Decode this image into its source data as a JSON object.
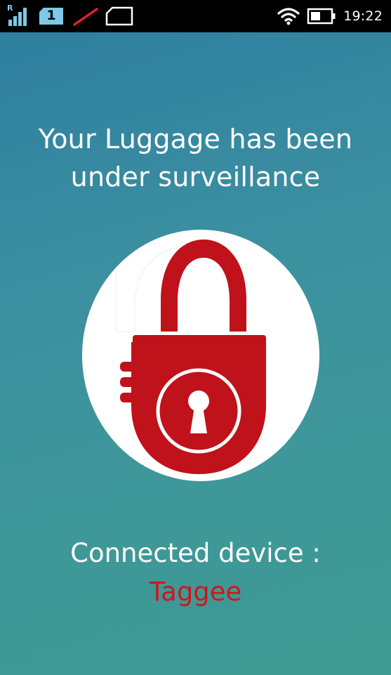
{
  "status_bar": {
    "roaming_indicator": "R",
    "sim_slot": "1",
    "time": "19:22",
    "icons": [
      "signal-roaming-icon",
      "sim-1-icon",
      "no-sim-icon",
      "wifi-icon",
      "battery-icon"
    ]
  },
  "main": {
    "headline_line1": "Your Luggage has been",
    "headline_line2": "under surveillance",
    "lock_image": "padlock-icon",
    "connected_label": "Connected device :",
    "device_name": "Taggee"
  },
  "colors": {
    "background_gradient_start": "#2f7fa0",
    "background_gradient_end": "#3f9a92",
    "lock_red": "#c0121a",
    "device_name_red": "#d0161b",
    "text_white": "#ffffff"
  }
}
